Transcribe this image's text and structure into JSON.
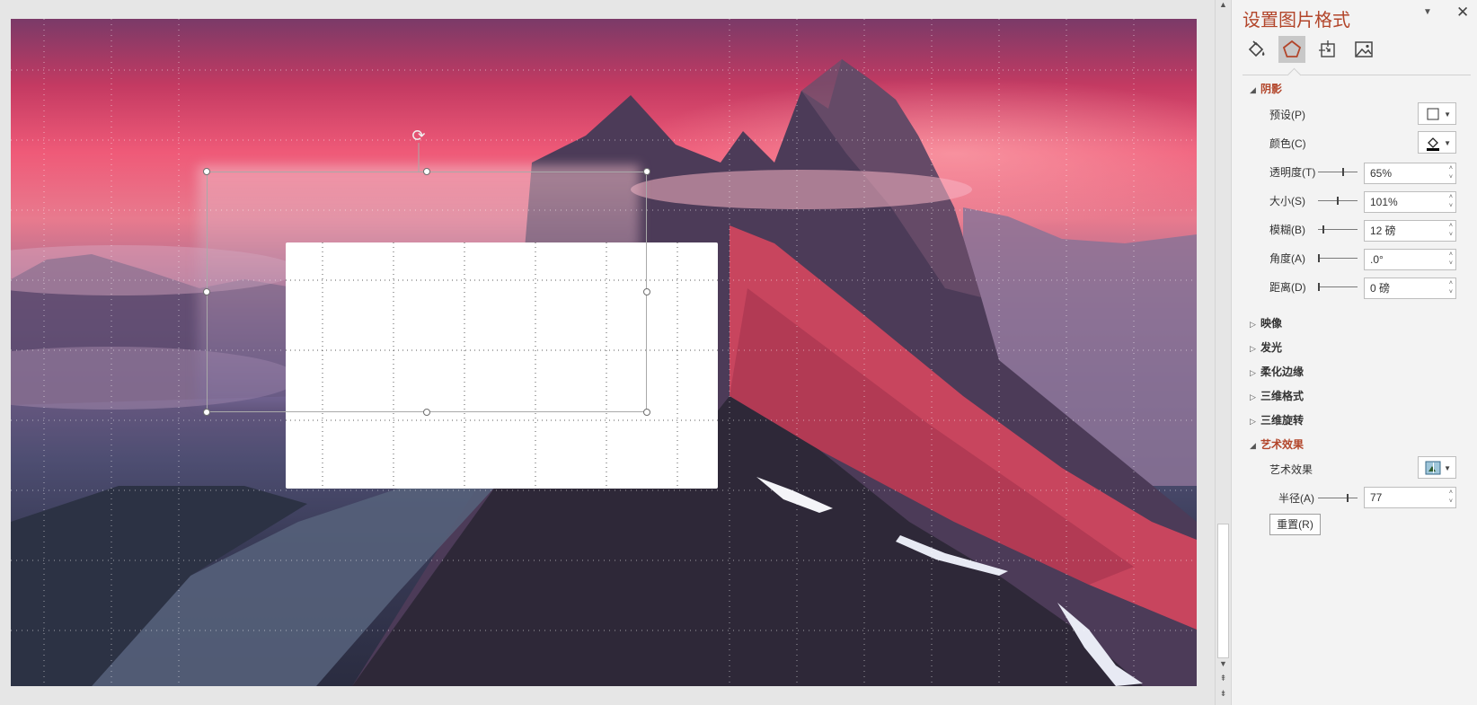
{
  "pane": {
    "title": "设置图片格式",
    "tabs": [
      {
        "name": "fill-line",
        "icon": "paint-bucket-icon"
      },
      {
        "name": "effects",
        "icon": "pentagon-icon",
        "active": true
      },
      {
        "name": "size-properties",
        "icon": "size-position-icon"
      },
      {
        "name": "picture",
        "icon": "picture-icon"
      }
    ],
    "shadow": {
      "heading": "阴影",
      "preset_label": "预设(P)",
      "color_label": "颜色(C)",
      "transparency_label": "透明度(T)",
      "transparency_value": "65%",
      "transparency_level": 0.65,
      "size_label": "大小(S)",
      "size_value": "101%",
      "size_level": 0.5,
      "blur_label": "模糊(B)",
      "blur_value": "12 磅",
      "blur_level": 0.12,
      "angle_label": "角度(A)",
      "angle_value": ".0°",
      "angle_level": 0,
      "distance_label": "距离(D)",
      "distance_value": "0 磅",
      "distance_level": 0
    },
    "collapsed_sections": [
      "映像",
      "发光",
      "柔化边缘",
      "三维格式",
      "三维旋转"
    ],
    "artistic": {
      "heading": "艺术效果",
      "effect_label": "艺术效果",
      "radius_label": "半径(A)",
      "radius_value": "77",
      "radius_level": 0.77,
      "reset_label": "重置(R)"
    }
  },
  "colors": {
    "accent": "#b2452a",
    "pane_bg": "#f3f3f3",
    "sky_top": "#7a3a68",
    "sky_glow": "#ef5a78"
  }
}
